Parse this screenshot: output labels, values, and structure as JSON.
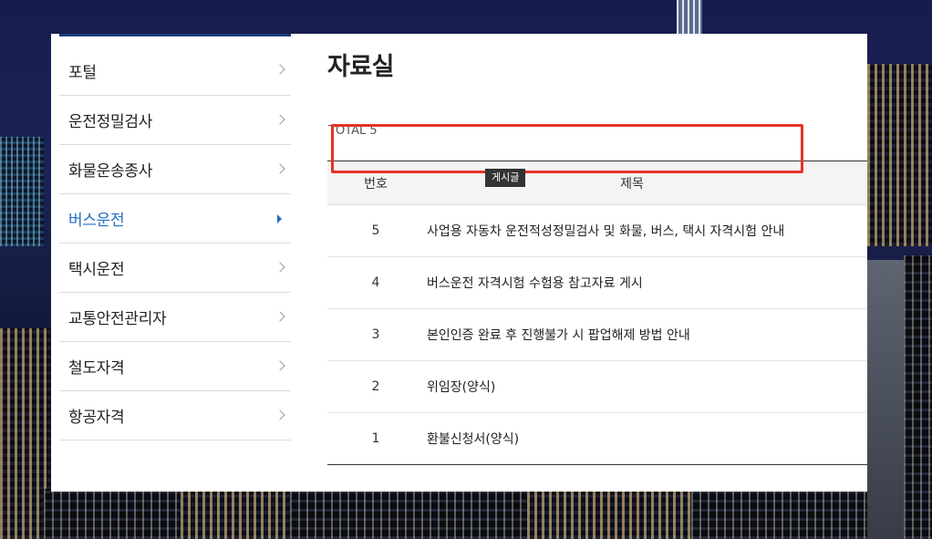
{
  "sidebar": {
    "items": [
      {
        "label": "포털"
      },
      {
        "label": "운전정밀검사"
      },
      {
        "label": "화물운송종사"
      },
      {
        "label": "버스운전",
        "active": true
      },
      {
        "label": "택시운전"
      },
      {
        "label": "교통안전관리자"
      },
      {
        "label": "철도자격"
      },
      {
        "label": "항공자격"
      }
    ]
  },
  "main": {
    "title": "자료실",
    "total": "TOTAL 5",
    "table": {
      "headers": {
        "number": "번호",
        "title": "제목"
      },
      "rows": [
        {
          "number": "5",
          "title": "사업용 자동차 운전적성정밀검사 및 화물, 버스, 택시 자격시험 안내"
        },
        {
          "number": "4",
          "title": "버스운전 자격시험 수험용 참고자료 게시"
        },
        {
          "number": "3",
          "title": "본인인증 완료 후 진행불가 시 팝업해제 방법 안내"
        },
        {
          "number": "2",
          "title": "위임장(양식)"
        },
        {
          "number": "1",
          "title": "환불신청서(양식)"
        }
      ]
    },
    "tooltip": "게시글"
  },
  "colors": {
    "accent": "#1f6fc4",
    "highlight": "#e53325",
    "sidebar_top_border": "#1b3a7a"
  }
}
